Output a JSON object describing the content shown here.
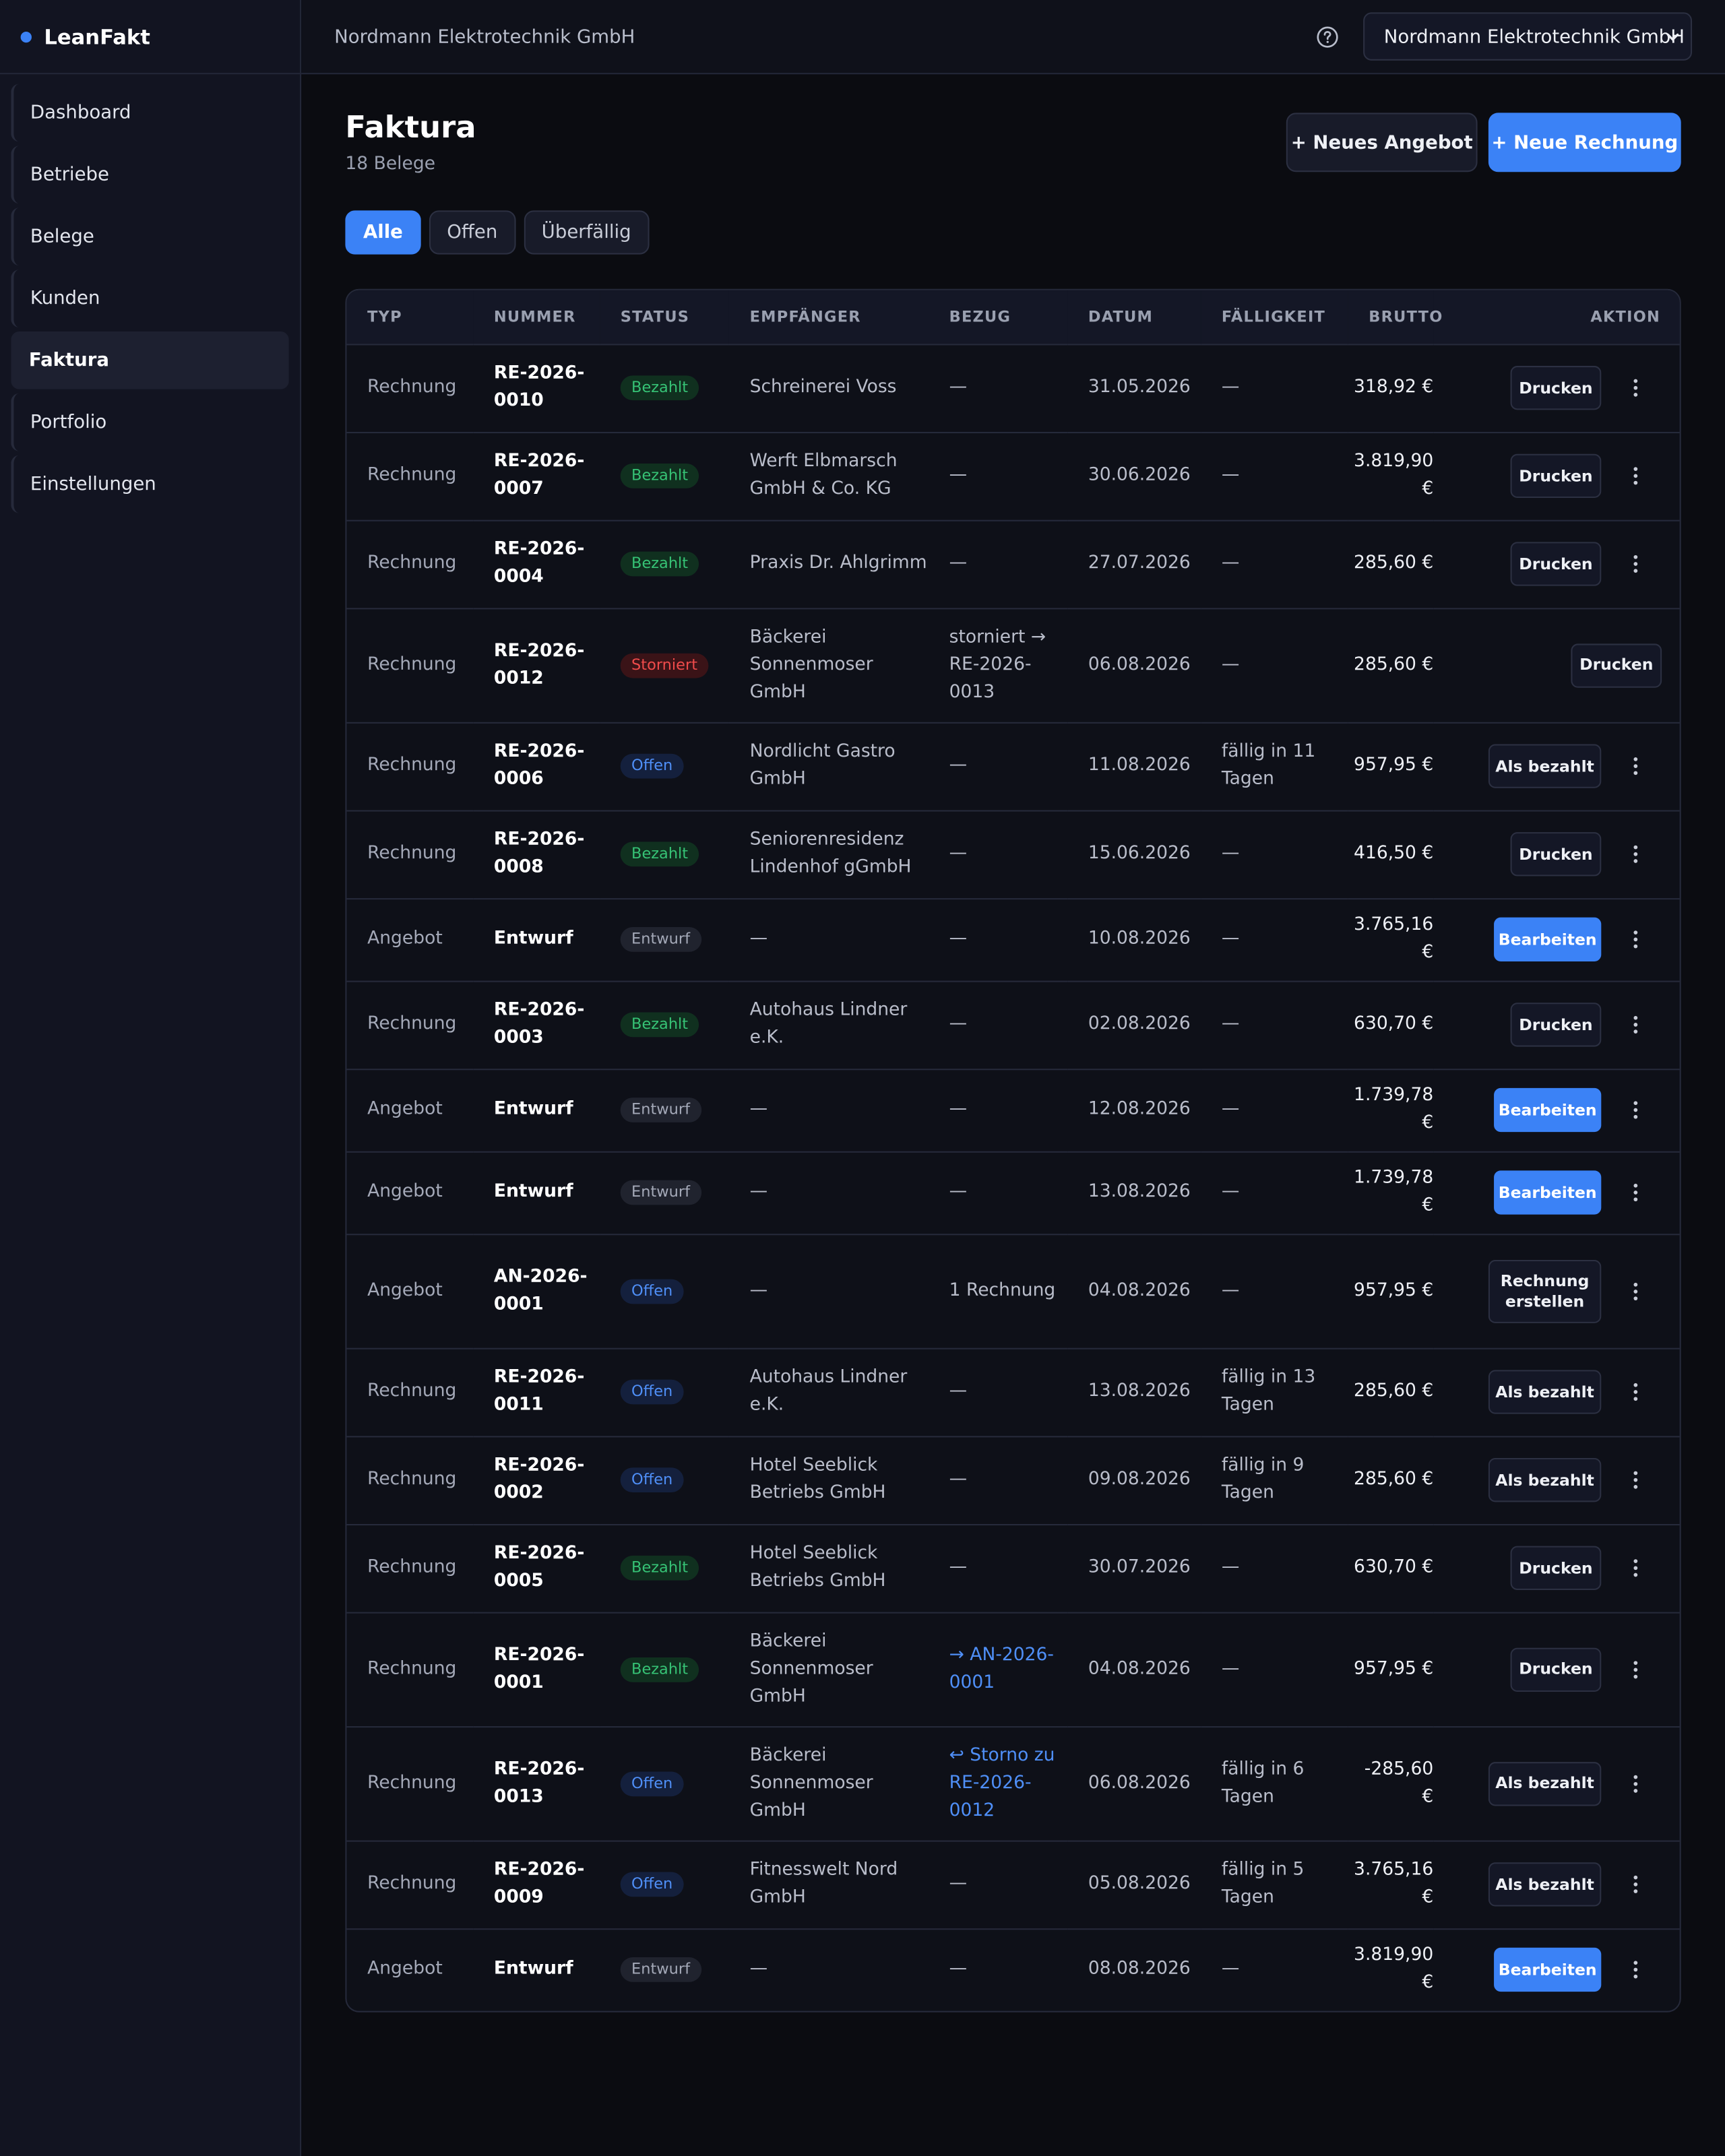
{
  "app": {
    "name": "LeanFakt"
  },
  "sidebar": {
    "items": [
      {
        "label": "Dashboard"
      },
      {
        "label": "Betriebe"
      },
      {
        "label": "Belege"
      },
      {
        "label": "Kunden"
      },
      {
        "label": "Faktura"
      },
      {
        "label": "Portfolio"
      },
      {
        "label": "Einstellungen"
      }
    ]
  },
  "topbar": {
    "title": "Nordmann Elektrotechnik GmbH",
    "org_select": "Nordmann Elektrotechnik GmbH"
  },
  "page": {
    "title": "Faktura",
    "subtitle": "18 Belege",
    "btn_new_offer": "+ Neues Angebot",
    "btn_new_invoice": "+ Neue Rechnung"
  },
  "filters": [
    "Alle",
    "Offen",
    "Überfällig"
  ],
  "table": {
    "headers": [
      "TYP",
      "NUMMER",
      "STATUS",
      "EMPFÄNGER",
      "BEZUG",
      "DATUM",
      "FÄLLIGKEIT",
      "BRUTTO",
      "AKTION"
    ],
    "rows": [
      {
        "typ": "Rechnung",
        "nummer": "RE-2026-0010",
        "status": "Bezahlt",
        "empfaenger": "Schreinerei Voss",
        "bezug": "—",
        "datum": "31.05.2026",
        "faelligkeit": "—",
        "brutto": "318,92 €",
        "aktion": "Drucken"
      },
      {
        "typ": "Rechnung",
        "nummer": "RE-2026-0007",
        "status": "Bezahlt",
        "empfaenger": "Werft Elbmarsch GmbH & Co. KG",
        "bezug": "—",
        "datum": "30.06.2026",
        "faelligkeit": "—",
        "brutto": "3.819,90 €",
        "aktion": "Drucken"
      },
      {
        "typ": "Rechnung",
        "nummer": "RE-2026-0004",
        "status": "Bezahlt",
        "empfaenger": "Praxis Dr. Ahlgrimm",
        "bezug": "—",
        "datum": "27.07.2026",
        "faelligkeit": "—",
        "brutto": "285,60 €",
        "aktion": "Drucken"
      },
      {
        "typ": "Rechnung",
        "nummer": "RE-2026-0012",
        "status": "Storniert",
        "empfaenger": "Bäckerei Sonnenmoser GmbH",
        "bezug": "storniert → RE-2026-0013",
        "datum": "06.08.2026",
        "faelligkeit": "—",
        "brutto": "285,60 €",
        "aktion": "Drucken"
      },
      {
        "typ": "Rechnung",
        "nummer": "RE-2026-0006",
        "status": "Offen",
        "empfaenger": "Nordlicht Gastro GmbH",
        "bezug": "—",
        "datum": "11.08.2026",
        "faelligkeit": "fällig in 11 Tagen",
        "brutto": "957,95 €",
        "aktion": "Als bezahlt"
      },
      {
        "typ": "Rechnung",
        "nummer": "RE-2026-0008",
        "status": "Bezahlt",
        "empfaenger": "Seniorenresidenz Lindenhof gGmbH",
        "bezug": "—",
        "datum": "15.06.2026",
        "faelligkeit": "—",
        "brutto": "416,50 €",
        "aktion": "Drucken"
      },
      {
        "typ": "Angebot",
        "nummer": "Entwurf",
        "status": "Entwurf",
        "empfaenger": "—",
        "bezug": "—",
        "datum": "10.08.2026",
        "faelligkeit": "—",
        "brutto": "3.765,16 €",
        "aktion": "Bearbeiten"
      },
      {
        "typ": "Rechnung",
        "nummer": "RE-2026-0003",
        "status": "Bezahlt",
        "empfaenger": "Autohaus Lindner e.K.",
        "bezug": "—",
        "datum": "02.08.2026",
        "faelligkeit": "—",
        "brutto": "630,70 €",
        "aktion": "Drucken"
      },
      {
        "typ": "Angebot",
        "nummer": "Entwurf",
        "status": "Entwurf",
        "empfaenger": "—",
        "bezug": "—",
        "datum": "12.08.2026",
        "faelligkeit": "—",
        "brutto": "1.739,78 €",
        "aktion": "Bearbeiten"
      },
      {
        "typ": "Angebot",
        "nummer": "Entwurf",
        "status": "Entwurf",
        "empfaenger": "—",
        "bezug": "—",
        "datum": "13.08.2026",
        "faelligkeit": "—",
        "brutto": "1.739,78 €",
        "aktion": "Bearbeiten"
      },
      {
        "typ": "Angebot",
        "nummer": "AN-2026-0001",
        "status": "Offen",
        "empfaenger": "—",
        "bezug": "1 Rechnung",
        "datum": "04.08.2026",
        "faelligkeit": "—",
        "brutto": "957,95 €",
        "aktion": "Rechnung erstellen"
      },
      {
        "typ": "Rechnung",
        "nummer": "RE-2026-0011",
        "status": "Offen",
        "empfaenger": "Autohaus Lindner e.K.",
        "bezug": "—",
        "datum": "13.08.2026",
        "faelligkeit": "fällig in 13 Tagen",
        "brutto": "285,60 €",
        "aktion": "Als bezahlt"
      },
      {
        "typ": "Rechnung",
        "nummer": "RE-2026-0002",
        "status": "Offen",
        "empfaenger": "Hotel Seeblick Betriebs GmbH",
        "bezug": "—",
        "datum": "09.08.2026",
        "faelligkeit": "fällig in 9 Tagen",
        "brutto": "285,60 €",
        "aktion": "Als bezahlt"
      },
      {
        "typ": "Rechnung",
        "nummer": "RE-2026-0005",
        "status": "Bezahlt",
        "empfaenger": "Hotel Seeblick Betriebs GmbH",
        "bezug": "—",
        "datum": "30.07.2026",
        "faelligkeit": "—",
        "brutto": "630,70 €",
        "aktion": "Drucken"
      },
      {
        "typ": "Rechnung",
        "nummer": "RE-2026-0001",
        "status": "Bezahlt",
        "empfaenger": "Bäckerei Sonnenmoser GmbH",
        "bezug": "→ AN-2026-0001",
        "datum": "04.08.2026",
        "faelligkeit": "—",
        "brutto": "957,95 €",
        "aktion": "Drucken"
      },
      {
        "typ": "Rechnung",
        "nummer": "RE-2026-0013",
        "status": "Offen",
        "empfaenger": "Bäckerei Sonnenmoser GmbH",
        "bezug": "↩ Storno zu RE-2026-0012",
        "datum": "06.08.2026",
        "faelligkeit": "fällig in 6 Tagen",
        "brutto": "-285,60 €",
        "aktion": "Als bezahlt"
      },
      {
        "typ": "Rechnung",
        "nummer": "RE-2026-0009",
        "status": "Offen",
        "empfaenger": "Fitnesswelt Nord GmbH",
        "bezug": "—",
        "datum": "05.08.2026",
        "faelligkeit": "fällig in 5 Tagen",
        "brutto": "3.765,16 €",
        "aktion": "Als bezahlt"
      },
      {
        "typ": "Angebot",
        "nummer": "Entwurf",
        "status": "Entwurf",
        "empfaenger": "—",
        "bezug": "—",
        "datum": "08.08.2026",
        "faelligkeit": "—",
        "brutto": "3.819,90 €",
        "aktion": "Bearbeiten"
      }
    ]
  },
  "icons": {
    "help": "help-circle-icon",
    "chevron": "chevron-down-icon",
    "more": "kebab-menu-icon"
  },
  "colors": {
    "accent": "#3b82f6",
    "paid": "#36c275",
    "open": "#4f8ff7",
    "cancelled": "#ef4b4b"
  }
}
